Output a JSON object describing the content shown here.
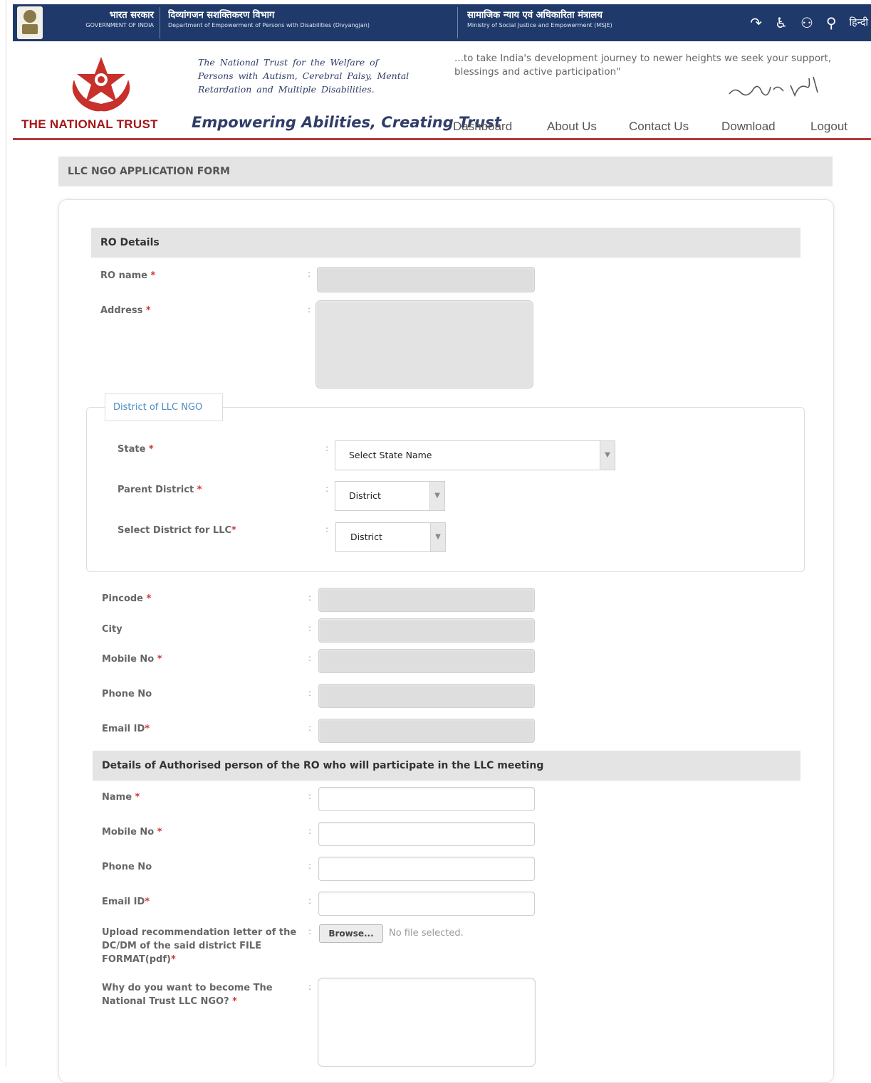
{
  "gov_bar": {
    "govt_hindi": "भारत सरकार",
    "govt_english": "GOVERNMENT OF INDIA",
    "dept_hindi": "दिव्यांगजन सशक्तिकरण विभाग",
    "dept_english": "Department of Empowerment of Persons with Disabilities (Divyangjan)",
    "ministry_hindi": "सामाजिक न्याय एवं अधिकारिता मंत्रालय",
    "ministry_english": "Ministry of Social Justice and Empowerment (MSJE)",
    "hindi_link": "हिन्दी"
  },
  "header": {
    "org_name": "THE NATIONAL TRUST",
    "trust_description": "The National Trust for the Welfare of Persons with Autism, Cerebral Palsy, Mental Retardation and Multiple Disabilities.",
    "tagline": "Empowering Abilities, Creating Trust",
    "quote": "...to take India's development journey to newer heights we seek your support, blessings and active participation\""
  },
  "nav": {
    "dashboard": "Dashboard",
    "about": "About Us",
    "contact": "Contact Us",
    "download": "Download",
    "logout": "Logout"
  },
  "page_title": "LLC NGO APPLICATION FORM",
  "ro_section": {
    "title": "RO Details",
    "ro_name": "RO name",
    "address": "Address",
    "pincode": "Pincode",
    "city": "City",
    "mobile": "Mobile No",
    "phone": "Phone No",
    "email": "Email ID"
  },
  "district_group": {
    "legend": "District of LLC NGO",
    "state_label": "State",
    "state_value": "Select State Name",
    "parent_district_label": "Parent District",
    "parent_district_value": "District",
    "llc_district_label": "Select District for LLC",
    "llc_district_value": "District"
  },
  "auth_section": {
    "title": "Details of Authorised person of the RO who will participate in the LLC meeting",
    "name": "Name",
    "mobile": "Mobile No",
    "phone": "Phone No",
    "email": "Email ID",
    "upload_label": "Upload recommendation letter of the DC/DM of the said district FILE FORMAT(pdf)",
    "browse": "Browse...",
    "no_file": "No file selected.",
    "why_label": "Why do you want to become The National Trust LLC NGO?"
  },
  "common": {
    "required_mark": "*",
    "colon": ":"
  },
  "colors": {
    "gov_bar": "#1f3a6a",
    "brand_red": "#a4171a",
    "brand_blue": "#2f3d68",
    "section_gray": "#e4e4e4",
    "legend_blue": "#4a8bc3"
  }
}
